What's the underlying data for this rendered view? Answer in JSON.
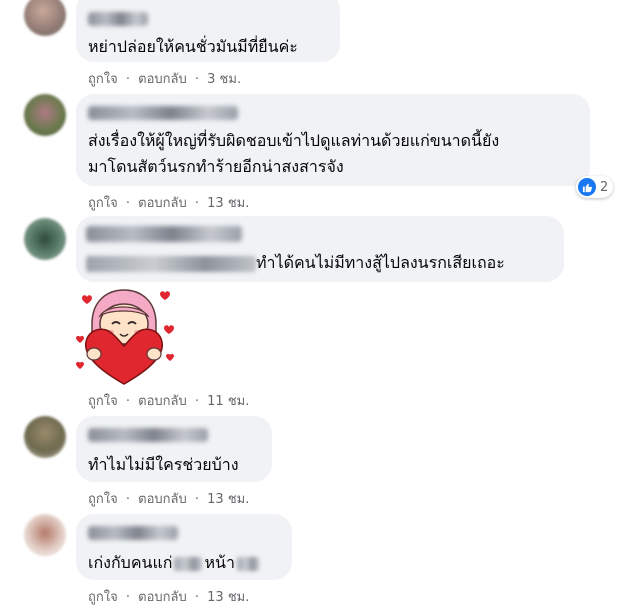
{
  "actions": {
    "like": "ถูกใจ",
    "separator": "·",
    "reply": "ตอบกลับ"
  },
  "comments": [
    {
      "text": "หย่าปล่อยให้คนชั่วมันมีที่ยืนค่ะ",
      "time": "3 ชม."
    },
    {
      "line1": "ส่งเรื่องให้ผู้ใหญ่ที่รับผิดชอบเข้าไปดูแลท่านด้วยแก่ขนาดนี้ยัง",
      "line2": "มาโดนสัตว์นรกทำร้ายอีกน่าสงสารจัง",
      "time": "13 ชม.",
      "reaction_count": "2",
      "reaction_icon": "like-icon"
    },
    {
      "text": "ทำได้คนไม่มีทางสู้ไปลงนรกเสียเถอะ",
      "time": "11 ชม.",
      "sticker_icon": "girl-holding-heart-sticker"
    },
    {
      "text": "ทำไมไม่มีใครช่วยบ้าง",
      "time": "13 ชม."
    },
    {
      "text_a": "เก่งกับคนแก่",
      "text_b": "หน้า",
      "time": "13 ชม."
    }
  ],
  "colors": {
    "bubble": "#f0f2f5",
    "meta": "#65676b",
    "like_blue": "#1877f2",
    "heart_red": "#e0262f",
    "hair_pink": "#f4a9c4"
  }
}
